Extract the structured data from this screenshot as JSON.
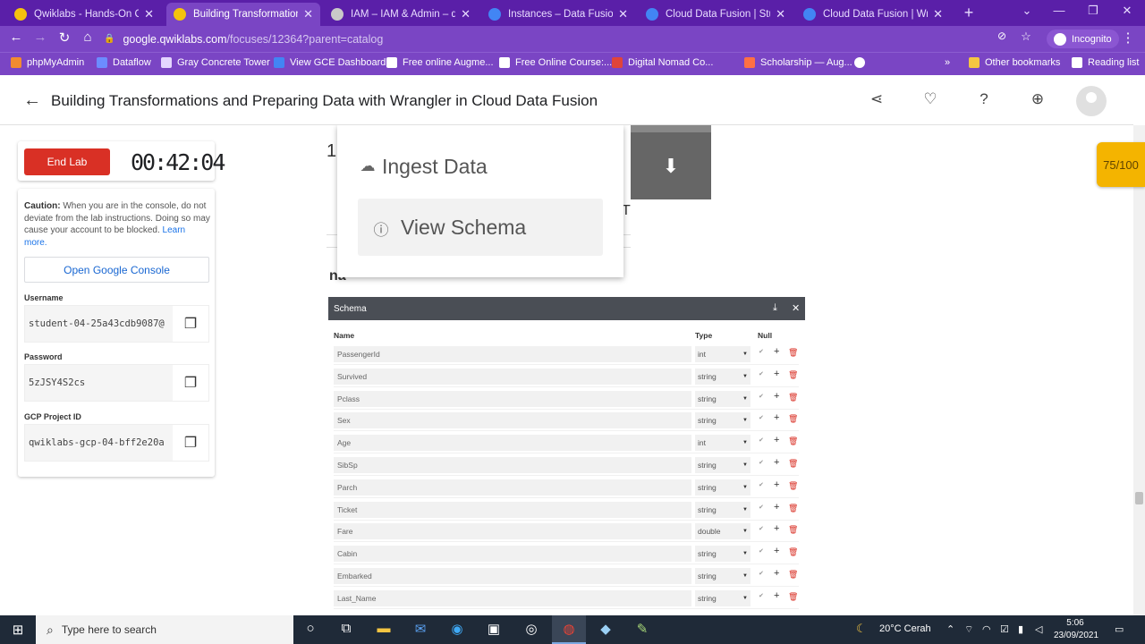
{
  "browser": {
    "tabs": [
      {
        "title": "Qwiklabs - Hands-On Cloud",
        "favicon_color": "#f4c20d"
      },
      {
        "title": "Building Transformations an",
        "favicon_color": "#f4c20d"
      },
      {
        "title": "IAM – IAM & Admin – qwik",
        "favicon_color": "#c9c9c9"
      },
      {
        "title": "Instances – Data Fusion – q",
        "favicon_color": "#4285f4"
      },
      {
        "title": "Cloud Data Fusion | Studio",
        "favicon_color": "#4285f4"
      },
      {
        "title": "Cloud Data Fusion | Wrangl",
        "favicon_color": "#4285f4"
      }
    ],
    "url_host": "google.qwiklabs.com",
    "url_path": "/focuses/12364?parent=catalog",
    "profile_label": "Incognito",
    "bookmarks": [
      "phpMyAdmin",
      "Dataflow",
      "Gray Concrete Tower",
      "View GCE Dashboard",
      "Free online Augme...",
      "Free Online Course:...",
      "Digital Nomad Co...",
      "Scholarship — Aug..."
    ],
    "other_bookmarks": "Other bookmarks",
    "reading_list": "Reading list",
    "overflow": "»"
  },
  "page": {
    "title": "Building Transformations and Preparing Data with Wrangler in Cloud Data Fusion",
    "score": "75/100"
  },
  "lab": {
    "end_button": "End Lab",
    "timer": "00:42:04",
    "caution_bold": "Caution:",
    "caution_text": " When you are in the console, do not deviate from the lab instructions. Doing so may cause your account to be blocked.",
    "learn_more": "Learn more.",
    "open_console": "Open Google Console",
    "username_label": "Username",
    "username_value": "student-04-25a43cdb9087@",
    "password_label": "Password",
    "password_value": "5zJSY4S2cs",
    "project_label": "GCP Project ID",
    "project_value": "qwiklabs-gcp-04-bff2e20a"
  },
  "content": {
    "menu_items": [
      "Ingest Data",
      "View Schema"
    ],
    "frag_1": "1",
    "frag_t": "T",
    "frag_na": "na",
    "schema_title": "Schema",
    "columns": {
      "name": "Name",
      "type": "Type",
      "null": "Null"
    },
    "rows": [
      {
        "name": "PassengerId",
        "type": "int"
      },
      {
        "name": "Survived",
        "type": "string"
      },
      {
        "name": "Pclass",
        "type": "string"
      },
      {
        "name": "Sex",
        "type": "string"
      },
      {
        "name": "Age",
        "type": "int"
      },
      {
        "name": "SibSp",
        "type": "string"
      },
      {
        "name": "Parch",
        "type": "string"
      },
      {
        "name": "Ticket",
        "type": "string"
      },
      {
        "name": "Fare",
        "type": "double"
      },
      {
        "name": "Cabin",
        "type": "string"
      },
      {
        "name": "Embarked",
        "type": "string"
      },
      {
        "name": "Last_Name",
        "type": "string"
      }
    ]
  },
  "taskbar": {
    "search_placeholder": "Type here to search",
    "weather": "20°C  Cerah",
    "time": "5:06",
    "date": "23/09/2021"
  }
}
